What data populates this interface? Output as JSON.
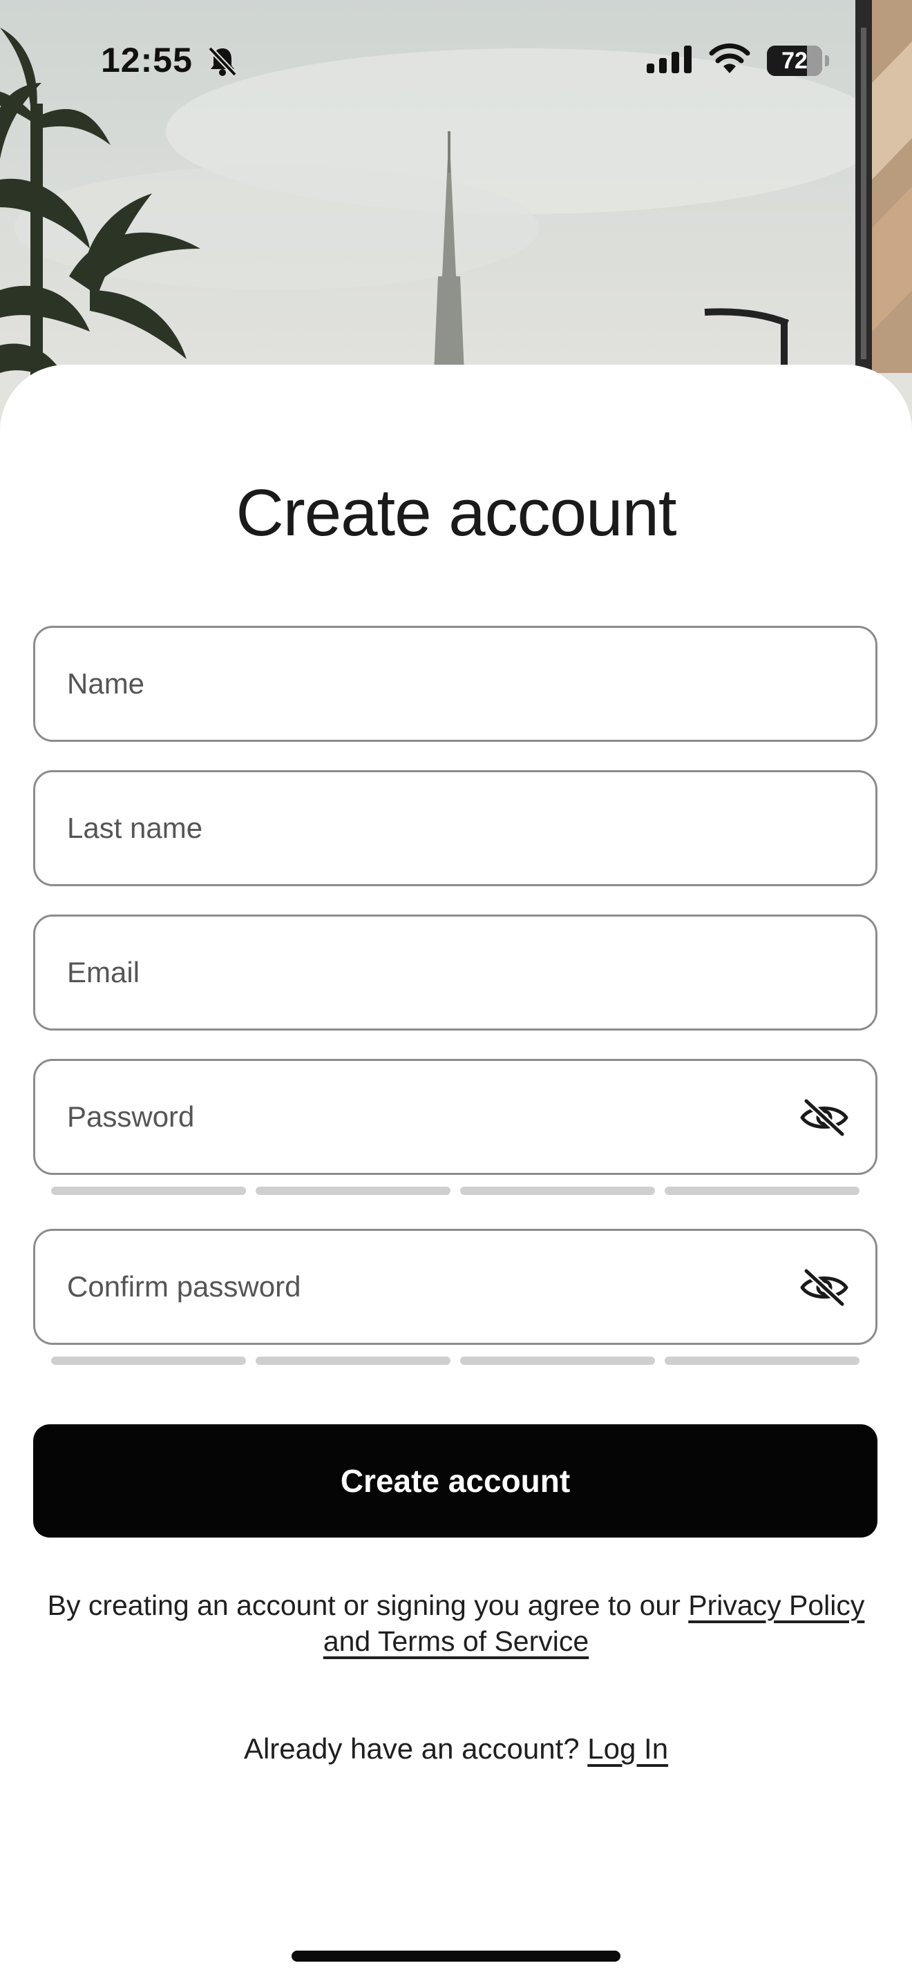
{
  "status_bar": {
    "time": "12:55",
    "battery_level": "72",
    "battery_fraction": 0.72
  },
  "form": {
    "title": "Create account",
    "fields": {
      "name_placeholder": "Name",
      "last_name_placeholder": "Last name",
      "email_placeholder": "Email",
      "password_placeholder": "Password",
      "confirm_password_placeholder": "Confirm password"
    },
    "submit_label": "Create account",
    "legal": {
      "prefix": "By creating an account or signing you agree to our ",
      "link": "Privacy Policy and Terms of Service"
    },
    "login": {
      "prompt": "Already have an account? ",
      "link": "Log In"
    }
  },
  "icons": {
    "status": [
      "bell-slash-icon",
      "cellular-signal-icon",
      "wifi-icon",
      "battery-icon"
    ],
    "password_toggle": "eye-slash-icon"
  },
  "colors": {
    "primary_button": "#050505",
    "field_border": "#8c8c8c",
    "strength_segment_empty": "#cfcfcf"
  }
}
